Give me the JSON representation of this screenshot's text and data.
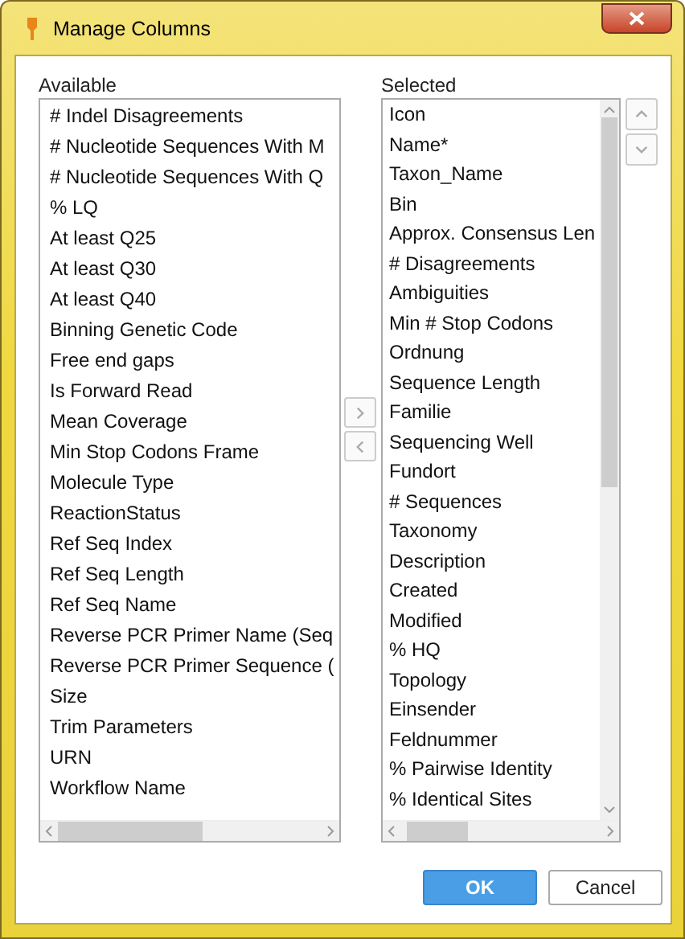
{
  "window": {
    "title": "Manage Columns"
  },
  "available": {
    "label": "Available",
    "items": [
      "# Indel Disagreements",
      "# Nucleotide Sequences With M",
      "# Nucleotide Sequences With Q",
      "% LQ",
      "At least Q25",
      "At least Q30",
      "At least Q40",
      "Binning Genetic Code",
      "Free end gaps",
      "Is Forward Read",
      "Mean Coverage",
      "Min Stop Codons Frame",
      "Molecule Type",
      "ReactionStatus",
      "Ref Seq Index",
      "Ref Seq Length",
      "Ref Seq Name",
      "Reverse PCR Primer Name (Seq",
      "Reverse PCR Primer Sequence (",
      "Size",
      "Trim Parameters",
      "URN",
      "Workflow Name"
    ]
  },
  "transfer_buttons": [
    {
      "kind": "add",
      "disabled": true
    },
    {
      "kind": "remove",
      "disabled": true
    }
  ],
  "selected": {
    "label": "Selected",
    "items": [
      "Icon",
      "Name*",
      "Taxon_Name",
      "Bin",
      "Approx. Consensus Len",
      "# Disagreements",
      "Ambiguities",
      "Min # Stop Codons",
      "Ordnung",
      "Sequence Length",
      "Familie",
      "Sequencing Well",
      "Fundort",
      "# Sequences",
      "Taxonomy",
      "Description",
      "Created",
      "Modified",
      "% HQ",
      "Topology",
      "Einsender",
      "Feldnummer",
      "% Pairwise Identity",
      "% Identical Sites"
    ]
  },
  "order_buttons": [
    {
      "kind": "up",
      "disabled": true
    },
    {
      "kind": "down",
      "disabled": true
    }
  ],
  "buttons": [
    {
      "label": "OK",
      "kind": "primary"
    },
    {
      "label": "Cancel",
      "kind": "secondary"
    }
  ]
}
